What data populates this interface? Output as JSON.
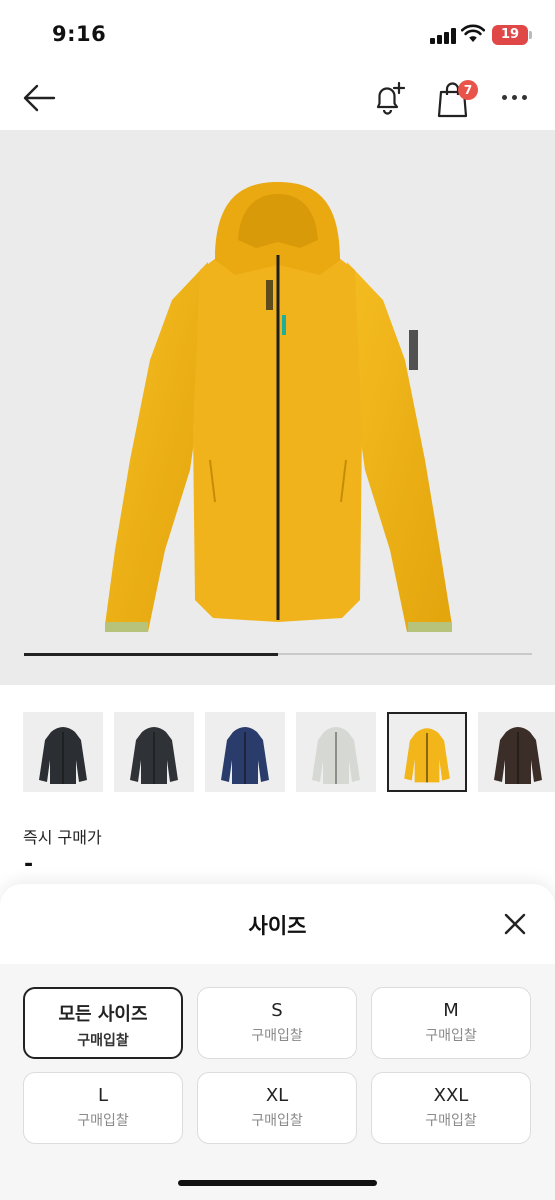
{
  "status_bar": {
    "time": "9:16",
    "battery": "19"
  },
  "nav": {
    "cart_count": "7"
  },
  "gallery": {
    "progress": 0.5
  },
  "colors": {
    "accent": "#e8534a",
    "jacket_selected": "#f2b51a"
  },
  "thumbnails": [
    {
      "color": "black"
    },
    {
      "color": "black"
    },
    {
      "color": "navy"
    },
    {
      "color": "light-gray"
    },
    {
      "color": "yellow",
      "selected": true
    },
    {
      "color": "brown"
    }
  ],
  "price": {
    "label": "즉시 구매가",
    "value": "-"
  },
  "size_sheet": {
    "title": "사이즈",
    "sizes": [
      {
        "name": "모든 사이즈",
        "sub": "구매입찰",
        "selected": true
      },
      {
        "name": "S",
        "sub": "구매입찰"
      },
      {
        "name": "M",
        "sub": "구매입찰"
      },
      {
        "name": "L",
        "sub": "구매입찰"
      },
      {
        "name": "XL",
        "sub": "구매입찰"
      },
      {
        "name": "XXL",
        "sub": "구매입찰"
      }
    ]
  }
}
